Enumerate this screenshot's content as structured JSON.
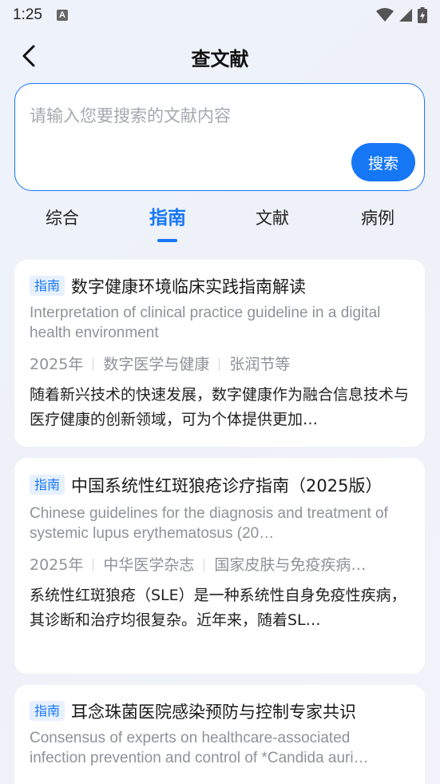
{
  "status_bar": {
    "time": "1:25",
    "a_icon": "A"
  },
  "header": {
    "title": "查文献"
  },
  "search": {
    "placeholder": "请输入您要搜索的文献内容",
    "button_label": "搜索"
  },
  "tabs": [
    {
      "label": "综合"
    },
    {
      "label": "指南",
      "active": true
    },
    {
      "label": "文献"
    },
    {
      "label": "病例"
    }
  ],
  "articles": [
    {
      "tag": "指南",
      "title": "数字健康环境临床实践指南解读",
      "subtitle": "Interpretation of clinical practice guideline in a digital health environment",
      "year": "2025年",
      "journal": "数字医学与健康",
      "authors": "张润节等",
      "abstract": "随着新兴技术的快速发展，数字健康作为融合信息技术与医疗健康的创新领域，可为个体提供更加…"
    },
    {
      "tag": "指南",
      "title": "中国系统性红斑狼疮诊疗指南（2025版）",
      "subtitle": "Chinese guidelines for the diagnosis and treatment of systemic lupus erythematosus (20…",
      "year": "2025年",
      "journal": "中华医学杂志",
      "authors": "国家皮肤与免疫疾病…",
      "abstract": "系统性红斑狼疮（SLE）是一种系统性自身免疫性疾病，其诊断和治疗均很复杂。近年来，随着SL…"
    },
    {
      "tag": "指南",
      "title": "耳念珠菌医院感染预防与控制专家共识",
      "subtitle": "Consensus of experts on healthcare-associated infection prevention and control of *Candida auri…"
    }
  ],
  "colors": {
    "accent": "#1677f5",
    "tag_bg": "#e6f0ff",
    "muted_text": "#8e9299"
  }
}
